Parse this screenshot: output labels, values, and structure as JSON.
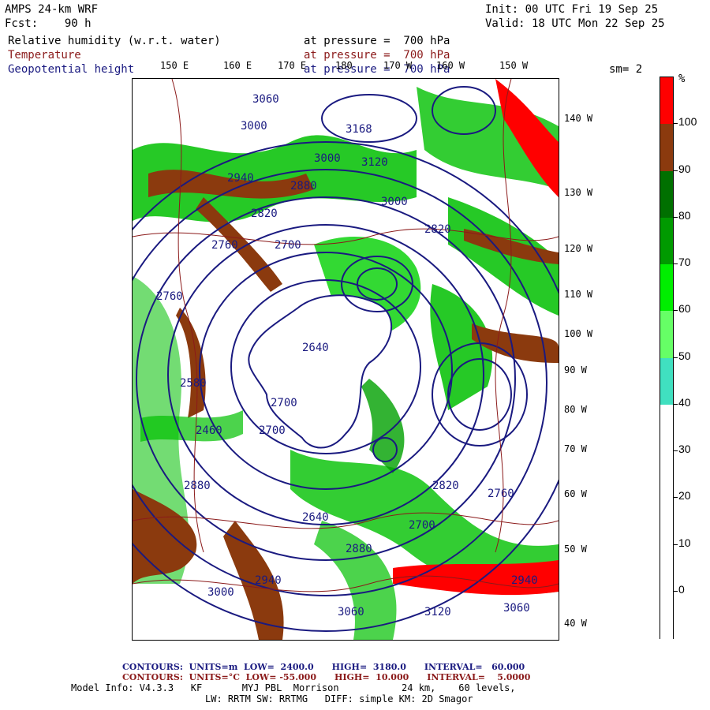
{
  "header": {
    "model": "AMPS 24-km WRF",
    "fcst": "Fcst:    90 h",
    "init": "Init: 00 UTC Fri 19 Sep 25",
    "valid": "Valid: 18 UTC Mon 22 Sep 25",
    "field1": "Relative humidity (w.r.t. water)",
    "field1_level": "at pressure =  700 hPa",
    "field2": "Temperature",
    "field2_level": "at pressure =  700 hPa",
    "field3": "Geopotential height",
    "field3_level": "at pressure =  700 hPa",
    "smooth": "sm= 2"
  },
  "lon_labels": [
    "150 E",
    "160 E",
    "170 E",
    "180",
    "170 W",
    "160 W",
    "150 W"
  ],
  "lat_labels": [
    "140 W",
    "130 W",
    "120 W",
    "110 W",
    "100 W",
    "90 W",
    "80 W",
    "70 W",
    "60 W",
    "50 W",
    "40 W"
  ],
  "colorbar": {
    "unit": "%",
    "labels": [
      "100",
      "90",
      "80",
      "70",
      "60",
      "50",
      "40",
      "30",
      "20",
      "10",
      "0"
    ],
    "colors": [
      "#ff0000",
      "#8b3a0e",
      "#007000",
      "#009a00",
      "#00ee00",
      "#66ff66",
      "#40e0c0",
      "#ffffff",
      "#ffffff",
      "#ffffff",
      "#ffffff",
      "#ffffff"
    ]
  },
  "height_labels": [
    "3060",
    "3000",
    "3168",
    "3120",
    "3000",
    "2940",
    "2880",
    "2820",
    "3000",
    "2760",
    "2700",
    "2820",
    "2760",
    "2640",
    "2580",
    "2700",
    "2460",
    "2700",
    "2880",
    "2820",
    "2760",
    "2700",
    "2640",
    "2880",
    "2940",
    "3000",
    "3060",
    "3120",
    "2940",
    "3060"
  ],
  "footer": {
    "line1_label": "CONTOURS:  UNITS=m  LOW=  2400.0      HIGH=  3180.0      INTERVAL=   60.000",
    "line2_label": "CONTOURS:  UNITS=°C  LOW= -55.000      HIGH=  10.000      INTERVAL=    5.0000",
    "line3": "Model Info: V4.3.3   KF       MYJ PBL  Morrison           24 km,    60 levels,",
    "line4": "LW: RRTM SW: RRTMG   DIFF: simple KM: 2D Smagor"
  },
  "colors": {
    "height_contour": "#1a1a80",
    "temp_contour": "#8b1a1a",
    "continent": "#ffffff"
  }
}
